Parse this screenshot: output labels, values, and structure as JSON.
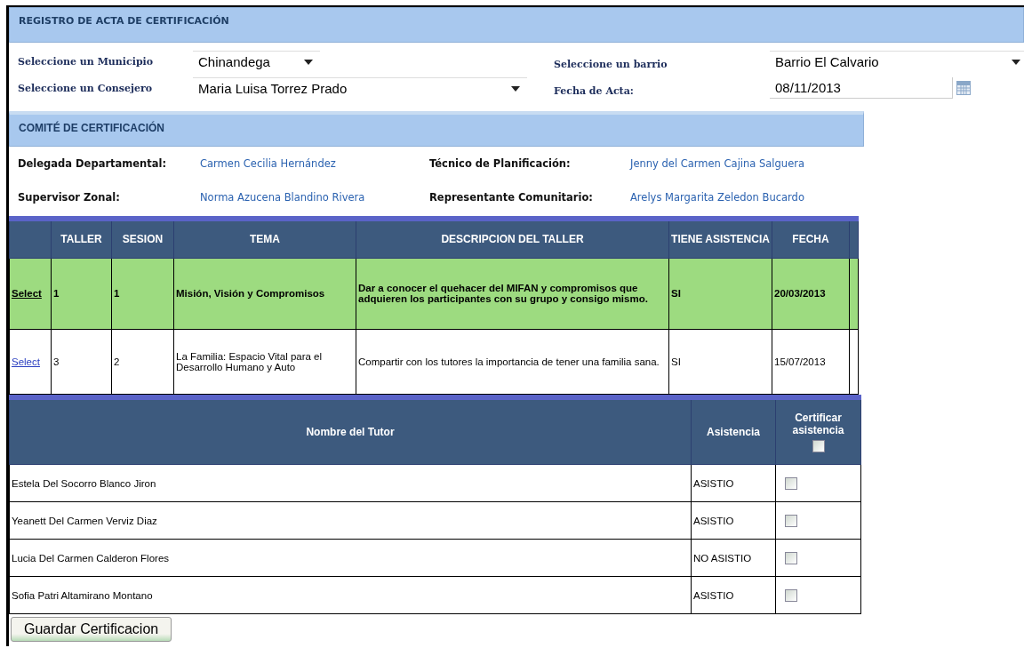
{
  "header": {
    "title": "REGISTRO DE ACTA DE CERTIFICACIÓN"
  },
  "form": {
    "municipio_label": "Seleccione un Municipio",
    "municipio": "Chinandega",
    "consejero_label": "Seleccione un Consejero",
    "consejero": "Maria Luisa Torrez Prado",
    "barrio_label": "Seleccione un barrio",
    "barrio": "Barrio El Calvario",
    "fecha_label": "Fecha de Acta:",
    "fecha": "08/11/2013"
  },
  "committee": {
    "title": "COMITÉ DE CERTIFICACIÓN",
    "members": [
      {
        "role": "Delegada Departamental:",
        "name": "Carmen Cecilia Hernández"
      },
      {
        "role": "Técnico de Planificación:",
        "name": "Jenny del Carmen Cajina Salguera"
      },
      {
        "role": "Supervisor Zonal:",
        "name": "Norma Azucena Blandino Rivera"
      },
      {
        "role": "Representante Comunitario:",
        "name": "Arelys Margarita Zeledon Bucardo"
      }
    ]
  },
  "workshops": {
    "columns": [
      "TALLER",
      "SESION",
      "TEMA",
      "DESCRIPCION DEL TALLER",
      "TIENE ASISTENCIA",
      "FECHA"
    ],
    "rows": [
      {
        "link": "Select",
        "taller": "1",
        "sesion": "1",
        "tema": "Misión, Visión y Compromisos",
        "descripcion": "Dar a conocer el quehacer del MIFAN y compromisos que adquieren los participantes con su grupo y consigo mismo.",
        "asistencia": "SI",
        "fecha": "20/03/2013",
        "selected": true
      },
      {
        "link": "Select",
        "taller": "3",
        "sesion": "2",
        "tema": "La Familia: Espacio Vital para el Desarrollo Humano y Auto",
        "descripcion": "Compartir con los tutores la importancia de tener una familia sana.",
        "asistencia": "SI",
        "fecha": "15/07/2013",
        "selected": false
      }
    ]
  },
  "tutors": {
    "columns": [
      "Nombre del Tutor",
      "Asistencia",
      "Certificar asistencia"
    ],
    "all_checked": false,
    "rows": [
      {
        "name": "Estela Del Socorro Blanco Jiron",
        "asistencia": "ASISTIO",
        "checked": false
      },
      {
        "name": "Yeanett Del Carmen Verviz Diaz",
        "asistencia": "ASISTIO",
        "checked": false
      },
      {
        "name": "Lucia Del Carmen Calderon Flores",
        "asistencia": "NO ASISTIO",
        "checked": false
      },
      {
        "name": "Sofia Patri Altamirano Montano",
        "asistencia": "ASISTIO",
        "checked": false
      }
    ]
  },
  "save_button": "Guardar Certificacion"
}
